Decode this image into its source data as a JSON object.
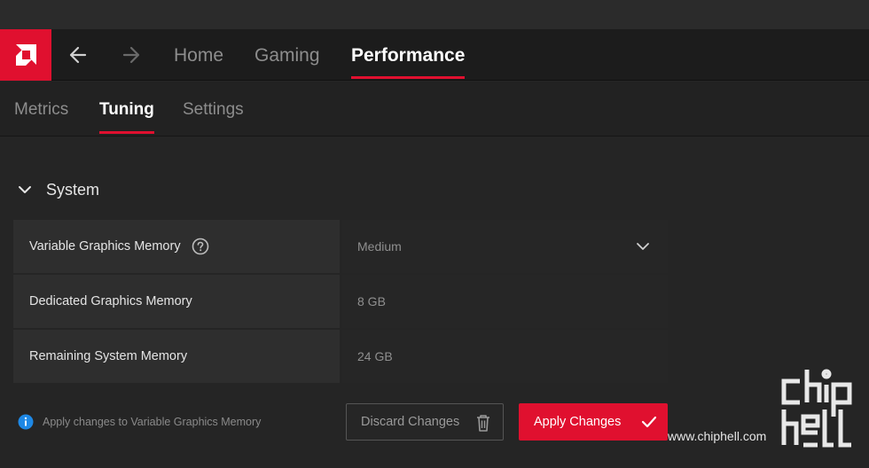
{
  "colors": {
    "accent": "#e0102f",
    "background": "#252525",
    "nav_bg": "#1c1c1c"
  },
  "nav": {
    "back_icon": "arrow-left-icon",
    "forward_icon": "arrow-right-icon",
    "tabs": [
      {
        "label": "Home",
        "active": false
      },
      {
        "label": "Gaming",
        "active": false
      },
      {
        "label": "Performance",
        "active": true
      }
    ]
  },
  "subnav": {
    "tabs": [
      {
        "label": "Metrics",
        "active": false
      },
      {
        "label": "Tuning",
        "active": true
      },
      {
        "label": "Settings",
        "active": false
      }
    ]
  },
  "section": {
    "title": "System",
    "expanded": true
  },
  "settings": [
    {
      "label": "Variable Graphics Memory",
      "value": "Medium",
      "has_help": true,
      "control": "dropdown"
    },
    {
      "label": "Dedicated Graphics Memory",
      "value": "8 GB"
    },
    {
      "label": "Remaining System Memory",
      "value": "24 GB"
    }
  ],
  "info": {
    "text": "Apply changes to Variable Graphics Memory"
  },
  "buttons": {
    "discard": "Discard Changes",
    "apply": "Apply Changes"
  },
  "watermark": {
    "text": "www.chiphell.com"
  }
}
